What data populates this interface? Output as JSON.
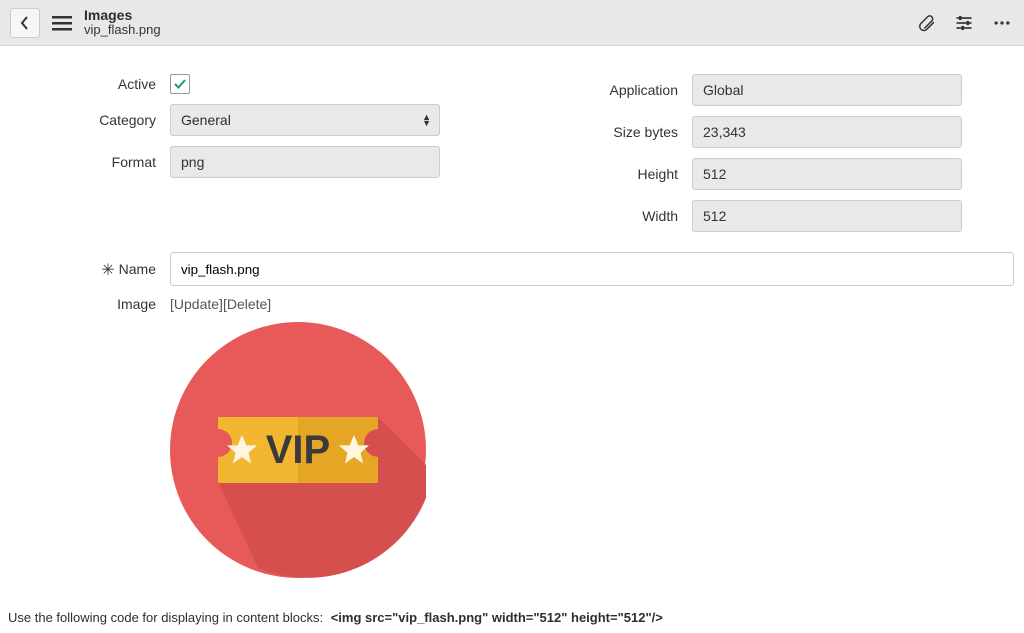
{
  "header": {
    "title": "Images",
    "subtitle": "vip_flash.png"
  },
  "labels": {
    "active": "Active",
    "category": "Category",
    "format": "Format",
    "application": "Application",
    "size_bytes": "Size bytes",
    "height": "Height",
    "width": "Width",
    "name": "Name",
    "image": "Image"
  },
  "fields": {
    "active_checked": true,
    "category": "General",
    "format": "png",
    "application": "Global",
    "size_bytes": "23,343",
    "height": "512",
    "width": "512",
    "name": "vip_flash.png"
  },
  "image_actions": {
    "update": "[Update]",
    "delete": "[Delete]"
  },
  "preview": {
    "badge_text": "VIP"
  },
  "code_hint": {
    "prefix": "Use the following code for displaying in content blocks:",
    "snippet": "<img src=\"vip_flash.png\" width=\"512\" height=\"512\"/>"
  }
}
